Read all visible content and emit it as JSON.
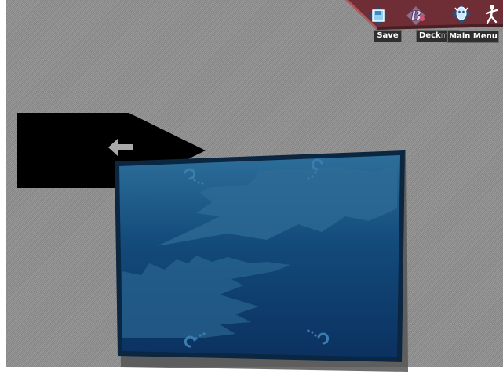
{
  "toolbar": {
    "save_label": "Save",
    "deck_label": "Deck",
    "deck_overlap_label": "me",
    "main_menu_label": "Main Menu",
    "icons": {
      "save": "save-disk-icon",
      "deck": "deck-b-icon",
      "options": "gem-figure-icon",
      "main_menu": "running-figure-icon"
    },
    "colors": {
      "bar": "#6f2e35",
      "bar_edge": "#b0585f",
      "label_bg": "#2e2e2e"
    }
  },
  "board": {
    "back_arrow_icon": "back-arrow-icon",
    "card_icon": "face-down-card-back",
    "colors": {
      "background": "#8d8d8d",
      "card_dark": "#0d3a66",
      "card_light": "#2d6e9a",
      "card_border": "#0a2640"
    }
  }
}
